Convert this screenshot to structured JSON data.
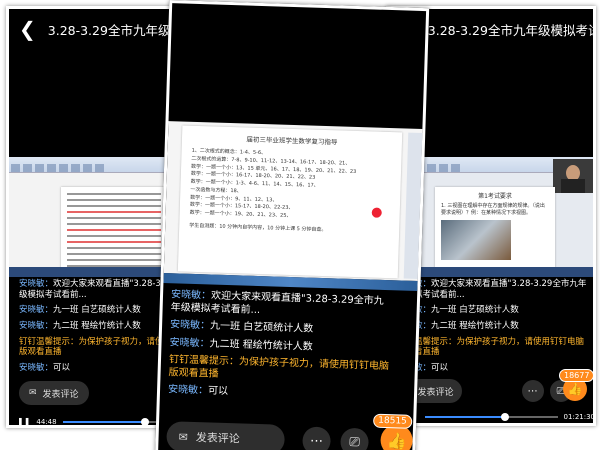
{
  "title": "3.28-3.29全市九年级模拟考试...",
  "left": {
    "chat": [
      {
        "name": "安晓敏：",
        "text": "欢迎大家来观看直播\"3.28-3.29全市九年级模拟考试看前..."
      },
      {
        "name": "安晓敏：",
        "text": "九一班 白艺硕统计人数"
      },
      {
        "name": "安晓敏：",
        "text": "九二班 程绘竹统计人数"
      },
      {
        "name": "钉钉温馨提示：",
        "text": "为保护孩子视力，请使用钉钉电脑版观看直播",
        "warn": true
      },
      {
        "name": "安晓敏：",
        "text": "可以"
      }
    ],
    "comment_label": "发表评论",
    "time_current": "44:48",
    "progress": 0.56
  },
  "center": {
    "doc_heading": "届初三毕业班学生数学复习指导",
    "doc_lines": [
      "1、二次根式的概念：1-4、5-6、",
      "二次根式的运算：7-8、9-10、11-12、13-14、16-17、18-20、21、",
      "数学：一题一个小：13、15 单元、16、17、18、19、20、21、22、23",
      "数学：一题一个小：16-17、18-20、20、21、22、23",
      "数学：一题一个小：1-3、4-6、11、14、15、16、17、",
      "一次函数与方程：18、",
      "数学：一题一个小：9、11、12、13、",
      "数学：一题一个小：15-17、18-20、22-23、",
      "数学：一题一个小：19、20、21、23、25、"
    ],
    "doc_footer": "学生自测题：10 分钟内自学内容，10 分钟上课 5 分钟自查。",
    "chat": [
      {
        "name": "安晓敏：",
        "text": "欢迎大家来观看直播\"3.28-3.29全市九年级模拟考试看前..."
      },
      {
        "name": "安晓敏：",
        "text": "九一班 白艺硕统计人数"
      },
      {
        "name": "安晓敏：",
        "text": "九二班 程绘竹统计人数"
      },
      {
        "name": "钉钉温馨提示：",
        "text": "为保护孩子视力，请使用钉钉电脑版观看直播",
        "warn": true
      },
      {
        "name": "安晓敏：",
        "text": "可以"
      }
    ],
    "comment_label": "发表评论",
    "like_count": "18515"
  },
  "right": {
    "doc_heading": "第1考试要求",
    "doc_text": "1. 三视图在理解中存在方面规律的规律。（说出要求说明）？例：在某种情况下求视图。",
    "chat": [
      {
        "name": "安晓敏：",
        "text": "欢迎大家来观看直播\"3.28-3.29全市九年级模拟考试看前..."
      },
      {
        "name": "安晓敏：",
        "text": "九一班 白艺硕统计人数"
      },
      {
        "name": "安晓敏：",
        "text": "九二班 程绘竹统计人数"
      },
      {
        "name": "钉钉温馨提示：",
        "text": "为保护孩子视力，请使用钉钉电脑版观看直播",
        "warn": true
      },
      {
        "name": "安晓敏：",
        "text": "可以"
      }
    ],
    "comment_label": "发表评论",
    "like_count": "18677",
    "time_total": "01:21:30",
    "progress": 0.6
  },
  "icons": {
    "back": "chevron-left-icon",
    "comment": "comment-icon",
    "more": "more-icon",
    "share": "share-icon",
    "like": "thumbs-up-icon",
    "pause": "pause-icon"
  }
}
